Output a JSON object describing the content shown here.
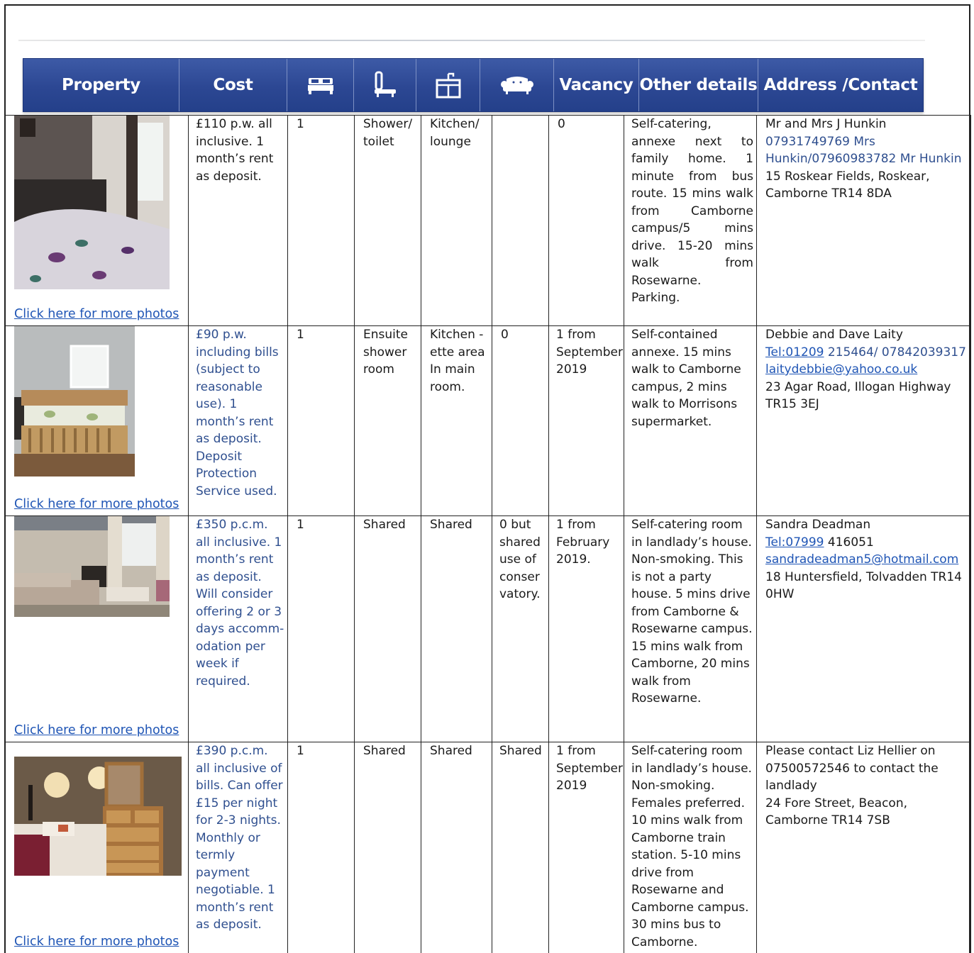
{
  "header": {
    "property": "Property",
    "cost": "Cost",
    "bed_icon": "bed-icon",
    "bath_icon": "bath-icon",
    "kitchen_icon": "kitchen-sink-icon",
    "lounge_icon": "sofa-icon",
    "vacancy": "Vacancy",
    "other": "Other details",
    "address": "Address /Contact"
  },
  "colors": {
    "header_bg": "#2c4793",
    "link": "#1f55b5",
    "accent_text": "#2f4f8f"
  },
  "more_photos": "Click here for more photos",
  "rows": [
    {
      "cost": "£110 p.w. all inclusive. 1 month’s rent as deposit.",
      "bed": "1",
      "bath": "Shower/ toilet",
      "kitchen": "Kitchen/ lounge",
      "lounge": "",
      "vacancy": "0",
      "details": "Self-catering, annexe next to family home. 1 minute from bus route. 15 mins walk from Camborne campus/5 mins drive. 15-20 mins walk from Rosewarne. Parking.",
      "contact_name": "Mr and Mrs J Hunkin",
      "contact_phone": "07931749769 Mrs Hunkin/07960983782 Mr Hunkin",
      "contact_address": "15 Roskear Fields, Roskear, Camborne TR14 8DA"
    },
    {
      "cost": "£90 p.w. including bills (subject to reasonable use). 1 month’s rent as deposit. Deposit Protection Service used.",
      "bed": "1",
      "bath": "Ensuite shower room",
      "kitchen": "Kitchen - ette area In main room.",
      "lounge": "0",
      "vacancy": "1 from September 2019",
      "details": "Self-contained annexe. 15 mins walk to Camborne campus, 2 mins walk to Morrisons supermarket.",
      "contact_name": "Debbie and Dave Laity",
      "contact_tel_link": "Tel:01209",
      "contact_tel_rest": "215464/ 07842039317",
      "contact_email": "laitydebbie@yahoo.co.uk",
      "contact_address": "23 Agar Road, Illogan Highway TR15 3EJ"
    },
    {
      "cost": "£350 p.c.m. all inclusive. 1 month’s rent as deposit. Will consider offering 2 or 3 days accomm- odation per week if required.",
      "bed": "1",
      "bath": "Shared",
      "kitchen": "Shared",
      "lounge": "0 but shared use of conser vatory.",
      "vacancy": "1 from February 2019.",
      "details": "Self-catering room in landlady’s house. Non-smoking. This is not a party house. 5 mins drive from Camborne & Rosewarne campus. 15 mins walk from Camborne, 20 mins walk from Rosewarne.",
      "contact_name": "Sandra Deadman",
      "contact_tel_link": "Tel:07999",
      "contact_tel_rest": "416051",
      "contact_email": "sandradeadman5@hotmail.com",
      "contact_address": "18 Huntersfield, Tolvadden TR14 0HW"
    },
    {
      "cost": "£390 p.c.m. all inclusive of bills. Can offer £15 per night for 2-3 nights. Monthly or termly payment negotiable. 1 month’s rent as deposit.",
      "bed": "1",
      "bath": "Shared",
      "kitchen": "Shared",
      "lounge": "Shared",
      "vacancy": "1 from September 2019",
      "details": "Self-catering room in landlady’s house. Non-smoking. Females preferred. 10 mins walk from Camborne train station. 5-10 mins drive from Rosewarne and Camborne campus. 30 mins bus to Camborne.",
      "contact_intro": "Please contact Liz Hellier on 07500572546 to contact the landlady",
      "contact_address": "24 Fore Street, Beacon, Camborne TR14 7SB"
    }
  ]
}
